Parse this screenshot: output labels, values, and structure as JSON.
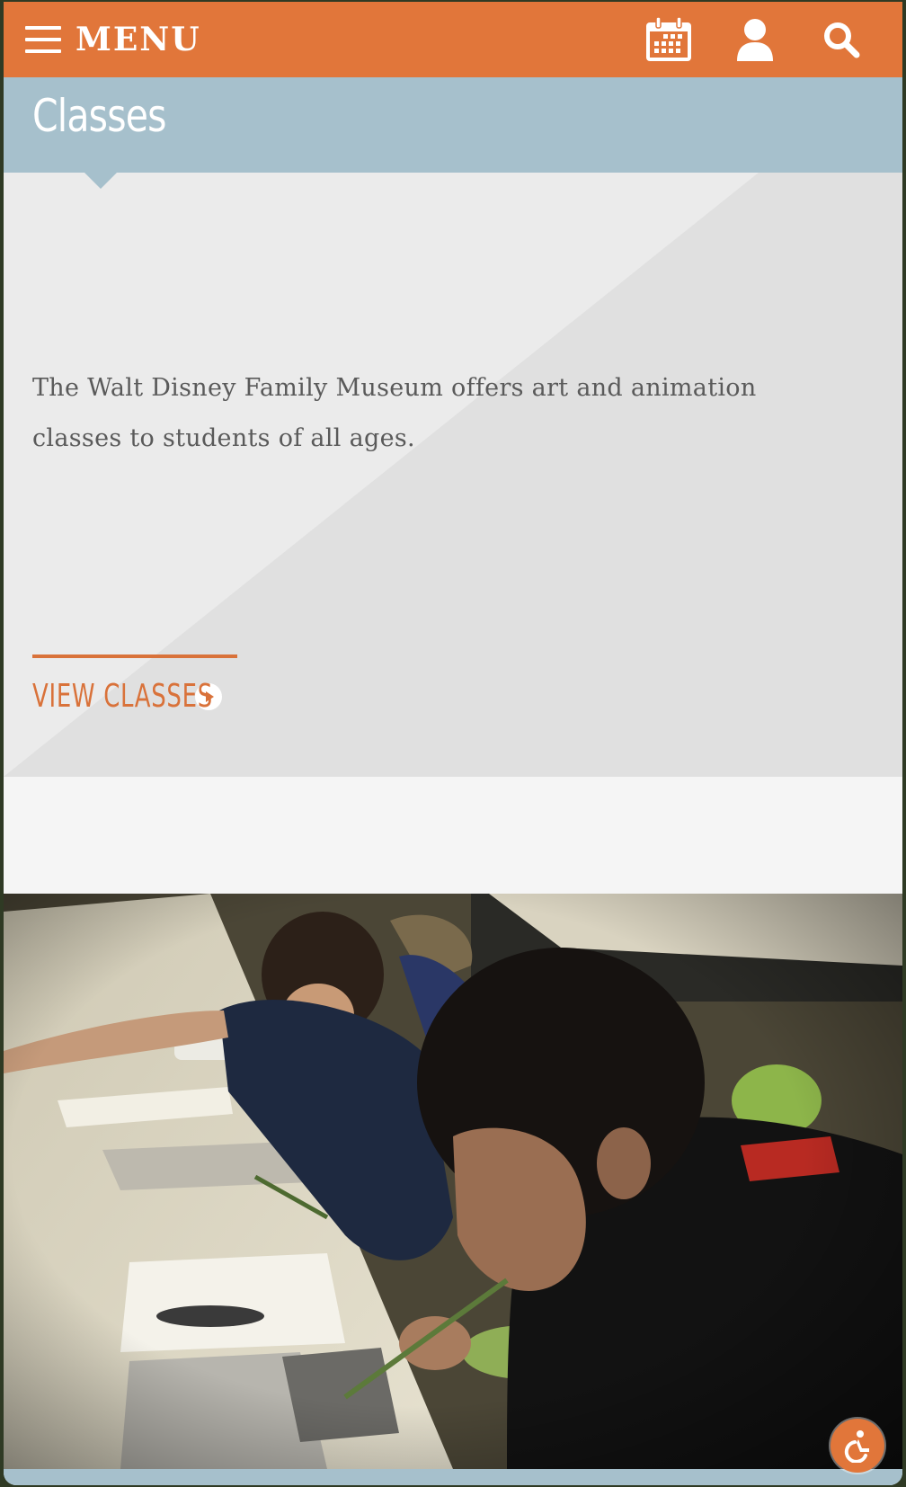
{
  "header": {
    "menu_label": "MENU",
    "icons": [
      "hamburger-icon",
      "calendar-icon",
      "user-icon",
      "search-icon"
    ],
    "background_color": "#e1763a"
  },
  "page": {
    "title": "Classes",
    "title_band_color": "#a6c0cc"
  },
  "intro": {
    "description": "The Walt Disney Family Museum offers art and animation classes to students of all ages.",
    "cta_label": "VIEW CLASSES",
    "cta_icon": "play-circle-icon",
    "accent_color": "#d9723a"
  },
  "photo": {
    "subject": "children-painting-at-table"
  },
  "accessibility": {
    "icon": "accessibility-icon"
  }
}
